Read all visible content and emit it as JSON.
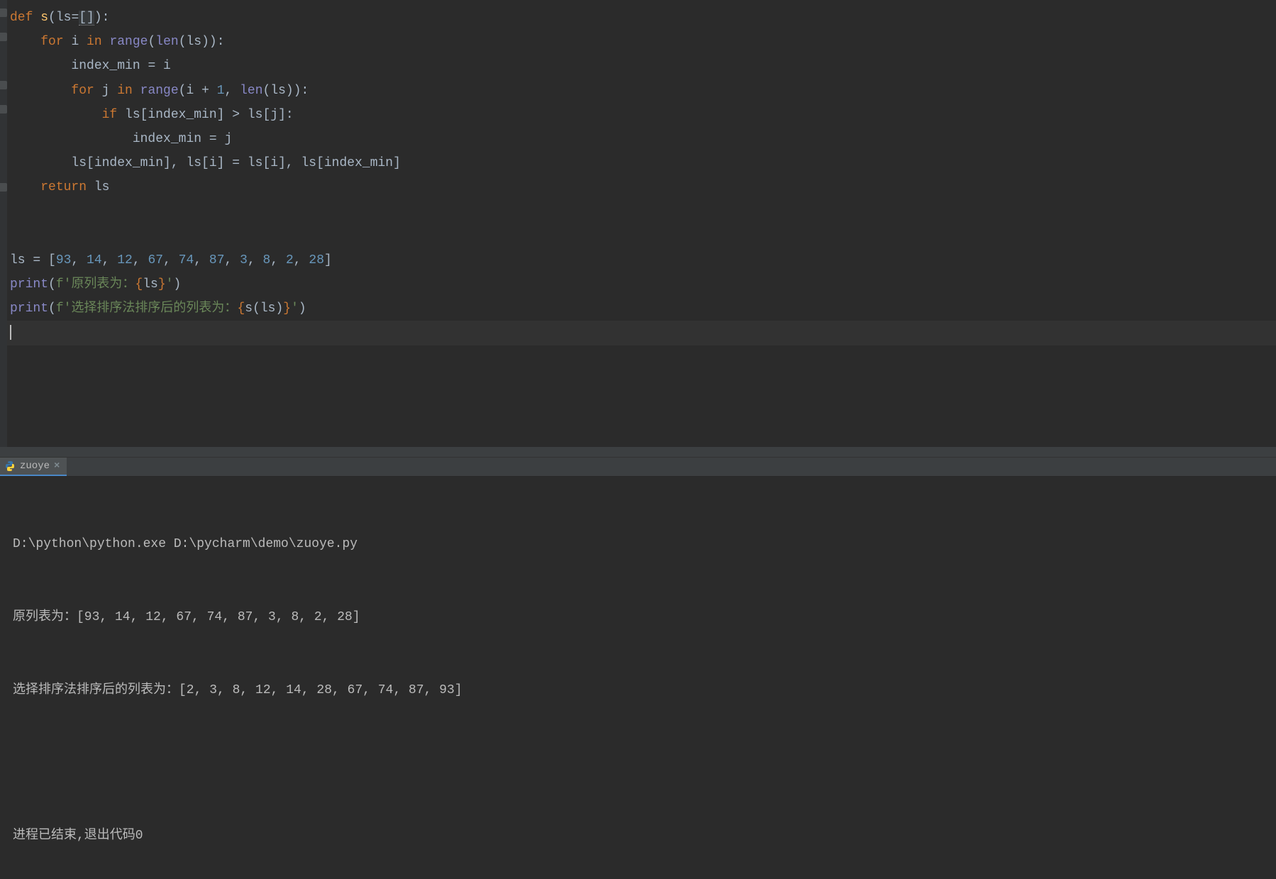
{
  "run_tab": {
    "label": "zuoye",
    "close_glyph": "×"
  },
  "code": {
    "l1": {
      "def": "def ",
      "fn": "s",
      "p1": "(ls",
      "eq": "=",
      "br": "[]",
      "p2": "):"
    },
    "l2": {
      "indent": "    ",
      "for": "for ",
      "i": "i ",
      "in": "in ",
      "range": "range",
      "p1": "(",
      "len": "len",
      "p2": "(ls)):"
    },
    "l3": {
      "indent": "        ",
      "txt": "index_min = i"
    },
    "l4": {
      "indent": "        ",
      "for": "for ",
      "j": "j ",
      "in": "in ",
      "range": "range",
      "p1": "(i + ",
      "one": "1",
      "comma": ", ",
      "len": "len",
      "p2": "(ls)):"
    },
    "l5": {
      "indent": "            ",
      "if": "if ",
      "txt": "ls[index_min] > ls[j]:"
    },
    "l6": {
      "indent": "                ",
      "txt": "index_min = j"
    },
    "l7": {
      "indent": "        ",
      "txt": "ls[index_min], ls[i] = ls[i], ls[index_min]"
    },
    "l8": {
      "indent": "    ",
      "ret": "return ",
      "txt": "ls"
    },
    "l11": {
      "ls": "ls = [",
      "n0": "93",
      "c0": ", ",
      "n1": "14",
      "c1": ", ",
      "n2": "12",
      "c2": ", ",
      "n3": "67",
      "c3": ", ",
      "n4": "74",
      "c4": ", ",
      "n5": "87",
      "c5": ", ",
      "n6": "3",
      "c6": ", ",
      "n7": "8",
      "c7": ", ",
      "n8": "2",
      "c8": ", ",
      "n9": "28",
      "close": "]"
    },
    "l12": {
      "print": "print",
      "p1": "(",
      "f": "f'",
      "txt": "原列表为：",
      "lb": "{",
      "var": "ls",
      "rb": "}",
      "endq": "'",
      "p2": ")"
    },
    "l13": {
      "print": "print",
      "p1": "(",
      "f": "f'",
      "txt": "选择排序法排序后的列表为：",
      "lb": "{",
      "fn": "s",
      "pl": "(",
      "var": "ls",
      "pr": ")",
      "rb": "}",
      "endq": "'",
      "p2": ")"
    }
  },
  "console": {
    "cmd": "D:\\python\\python.exe D:\\pycharm\\demo\\zuoye.py",
    "out1": "原列表为：[93, 14, 12, 67, 74, 87, 3, 8, 2, 28]",
    "out2": "选择排序法排序后的列表为：[2, 3, 8, 12, 14, 28, 67, 74, 87, 93]",
    "exit": "进程已结束,退出代码0"
  }
}
